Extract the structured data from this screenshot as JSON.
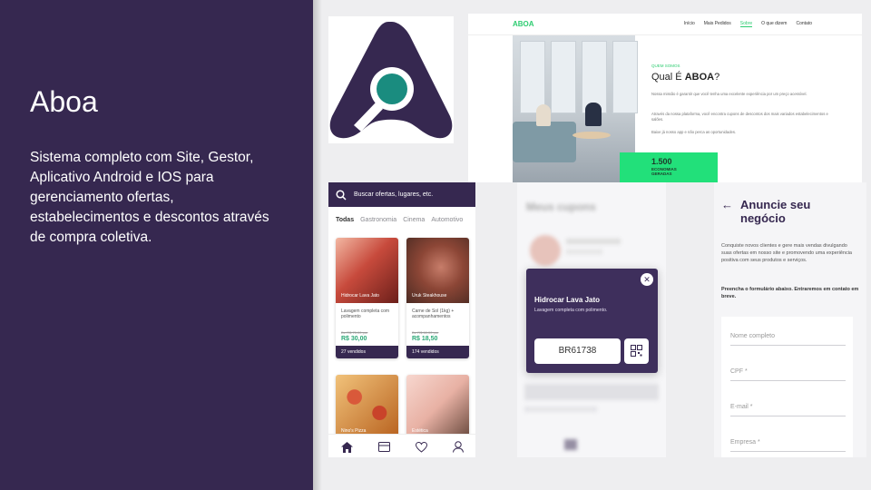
{
  "left": {
    "title": "Aboa",
    "description": "Sistema completo com Site, Gestor, Aplicativo Android e IOS para gerenciamento ofertas, estabelecimentos  e descontos através de compra coletiva."
  },
  "colors": {
    "brand_purple": "#362850",
    "brand_teal": "#1a8c7f",
    "accent_green": "#22e07a"
  },
  "site": {
    "logo": "ABOA",
    "nav": [
      "Início",
      "Mais Pedidos",
      "Sobre",
      "O que dizem",
      "Contato"
    ],
    "active_nav": "Sobre",
    "eyebrow": "QUEM SOMOS",
    "heading_prefix": "Qual É ",
    "heading_bold": "ABOA",
    "heading_suffix": "?",
    "paragraphs": [
      "Nossa missão é garantir que você tenha uma excelente experiência por um preço acessível.",
      "Através da nossa plataforma, você encontra cupons de descontos dos mais variados estabelecimentos e salões.",
      "Baixe já nosso app e não perca as oportunidades."
    ],
    "stat_value": "1.500",
    "stat_label": "ECONOMIAS GERADAS"
  },
  "app": {
    "search_placeholder": "Buscar ofertas, lugares, etc.",
    "tabs": [
      "Todas",
      "Gastronomia",
      "Cinema",
      "Automotivo"
    ],
    "active_tab": "Todas",
    "products": [
      {
        "name": "Hidrocar Lava Jato",
        "desc": "Lavagem completa com polimento",
        "old_price": "De R$ 70,00 por",
        "price": "R$ 30,00",
        "sold": "27 vendidos"
      },
      {
        "name": "Uruk Steakhouse",
        "desc": "Carne de Sol (1kg) + acompanhamentos",
        "old_price": "De R$ 60,00 por",
        "price": "R$ 18,50",
        "sold": "174 vendidos"
      },
      {
        "name": "Nino's Pizza"
      },
      {
        "name": "Estética"
      }
    ],
    "bottom_nav": [
      "home-icon",
      "coupon-icon",
      "heart-icon",
      "user-icon"
    ]
  },
  "coupons": {
    "title": "Meus cupons",
    "modal": {
      "name": "Hidrocar Lava Jato",
      "desc": "Lavagem completa com polimento.",
      "code": "BR61738"
    }
  },
  "form": {
    "title": "Anuncie seu negócio",
    "text": "Conquiste novos clientes e gere mais vendas divulgando suas ofertas em nosso site e promovendo uma experiência positiva com seus produtos e serviços.",
    "bold_text": "Preencha o formulário abaixo. Entraremos em contato em breve.",
    "fields": [
      "Nome completo",
      "CPF *",
      "E-mail *",
      "Empresa *"
    ]
  }
}
